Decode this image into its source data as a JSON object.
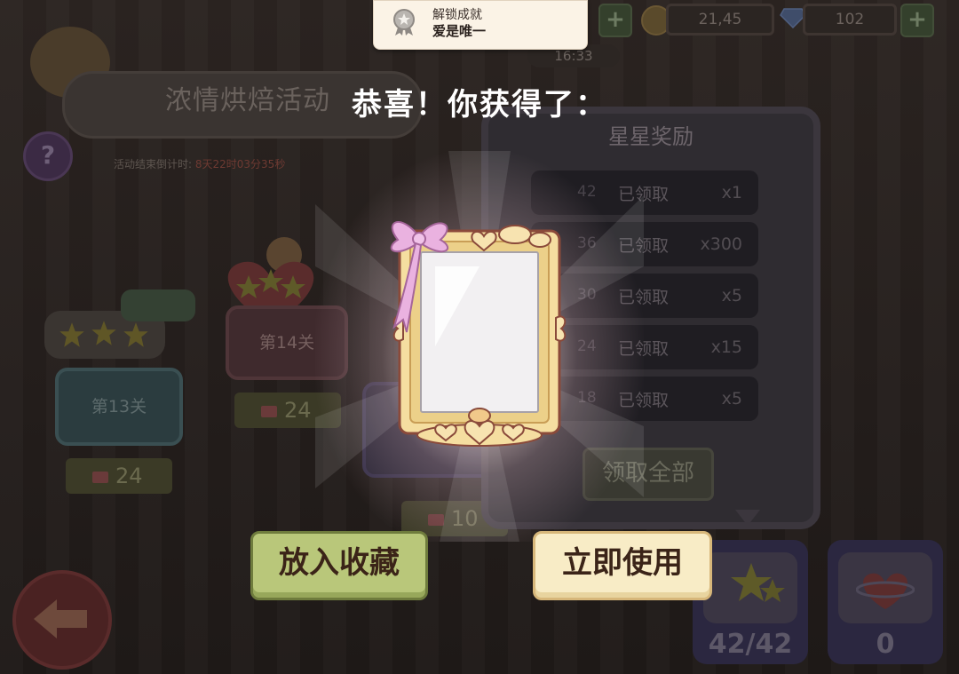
{
  "toast": {
    "line1": "解锁成就",
    "line2": "爱是唯一"
  },
  "topbar": {
    "coins": "21,45",
    "gems": "102",
    "plus": "+",
    "time": "16:33"
  },
  "event": {
    "title": "浓情烘焙活动",
    "countdown_label": "活动结束倒计时:",
    "countdown_value": "8天22时03分35秒",
    "help": "?"
  },
  "levels": [
    {
      "label": "第13关",
      "cost": "24"
    },
    {
      "label": "第14关",
      "cost": "24"
    },
    {
      "label": "",
      "cost": "10"
    }
  ],
  "star_panel": {
    "title": "星星奖励",
    "rows": [
      {
        "num": "42",
        "status": "已领取",
        "qty": "x1"
      },
      {
        "num": "36",
        "status": "已领取",
        "qty": "x300"
      },
      {
        "num": "30",
        "status": "已领取",
        "qty": "x5"
      },
      {
        "num": "24",
        "status": "已领取",
        "qty": "x15"
      },
      {
        "num": "18",
        "status": "已领取",
        "qty": "x5"
      }
    ],
    "claim_all": "领取全部"
  },
  "bottom_tiles": {
    "stars": "42/42",
    "hearts": "0"
  },
  "reward": {
    "congrats": "恭喜！你获得了：",
    "item_icon": "mirror-frame-icon",
    "collect_label": "放入收藏",
    "use_label": "立即使用"
  },
  "colors": {
    "collect_button": "#b9c77a",
    "use_button": "#f8ecc6",
    "ribbon": "#e9a8d8",
    "frame_gold": "#f3d99a"
  }
}
